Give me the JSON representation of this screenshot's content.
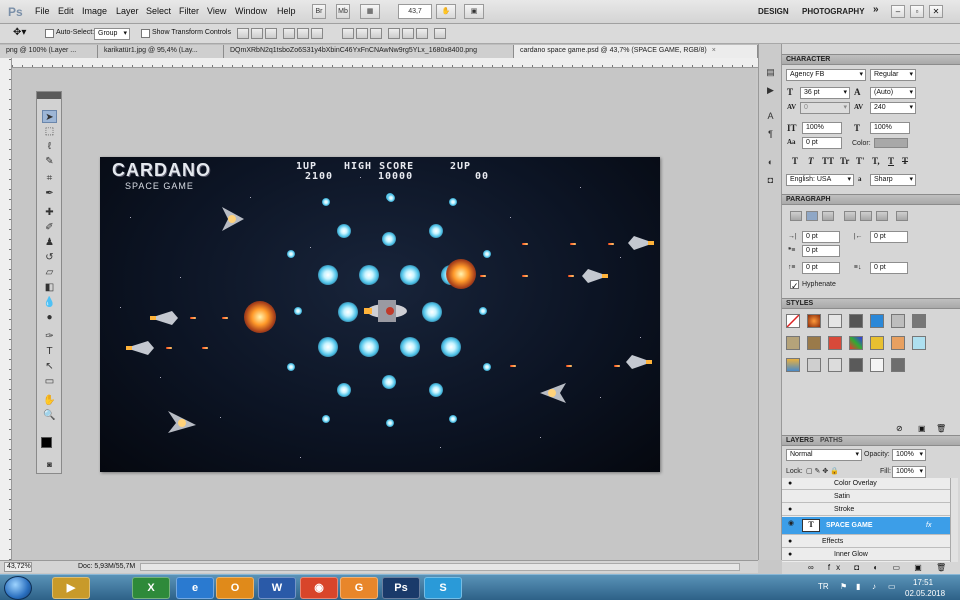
{
  "app": {
    "logo": "Ps"
  },
  "menu": [
    "File",
    "Edit",
    "Image",
    "Layer",
    "Select",
    "Filter",
    "View",
    "Window",
    "Help"
  ],
  "menubar_buttons": {
    "bridge": "Br",
    "minibridge": "Mb",
    "zoom": "43,7"
  },
  "workspace_links": {
    "design": "DESIGN",
    "photography": "PHOTOGRAPHY",
    "more": "»"
  },
  "window_controls": {
    "minimize": "–",
    "restore": "▫",
    "close": "✕"
  },
  "options": {
    "auto_select_label": "Auto-Select:",
    "auto_select_value": "Group",
    "show_transform_label": "Show Transform Controls"
  },
  "tabs": [
    {
      "label": "png @ 100% (Layer ...",
      "active": false
    },
    {
      "label": "karikatür1.jpg @ 95,4% (Lay...",
      "active": false
    },
    {
      "label": "DQmXRbN2q1tsboZo6S31y4bXbinC46YxFnCNAwNw9rg5YLx_1680x8400.png",
      "active": false
    },
    {
      "label": "cardano space game.psd @ 43,7% (SPACE GAME, RGB/8)",
      "active": true
    }
  ],
  "canvas": {
    "title": "CARDANO",
    "subtitle": "SPACE GAME",
    "hud": {
      "p1_label": "1UP",
      "p1_score": "2100",
      "hi_label": "HIGH SCORE",
      "hi_score": "10000",
      "p2_label": "2UP",
      "p2_score": "00"
    }
  },
  "status": {
    "zoom": "43,72%",
    "doc": "Doc: 5,93M/55,7M"
  },
  "character": {
    "title": "CHARACTER",
    "font_family": "Agency FB",
    "font_style": "Regular",
    "size": "36 pt",
    "leading": "(Auto)",
    "kerning": "0",
    "tracking": "240",
    "vscale": "100%",
    "hscale": "100%",
    "baseline": "0 pt",
    "color_label": "Color:",
    "language": "English: USA",
    "aa_label": "a",
    "antialias": "Sharp",
    "type_buttons": [
      "T",
      "T",
      "TT",
      "Tr",
      "T'",
      "T,",
      "T",
      "T"
    ]
  },
  "paragraph": {
    "title": "PARAGRAPH",
    "indent_left": "0 pt",
    "indent_right": "0 pt",
    "indent_first": "0 pt",
    "space_before": "0 pt",
    "space_after": "0 pt",
    "hyphenate_label": "Hyphenate"
  },
  "styles": {
    "title": "STYLES"
  },
  "layers": {
    "tabs": [
      "LAYERS",
      "PATHS"
    ],
    "blend_mode": "Normal",
    "opacity_label": "Opacity:",
    "opacity": "100%",
    "lock_label": "Lock:",
    "fill_label": "Fill:",
    "fill": "100%",
    "rows": [
      "Color Overlay",
      "Satin",
      "Stroke",
      "SPACE GAME",
      "Effects",
      "Inner Glow"
    ],
    "selected_layer_thumb": "T",
    "fx": "fx"
  },
  "taskbar": {
    "apps": [
      "▶",
      "X",
      "e",
      "O",
      "W",
      "◉",
      "G",
      "Ps",
      "S"
    ],
    "lang": "TR",
    "time": "17:51",
    "date": "02.05.2018"
  },
  "colors": {
    "accent_select": "#3c9ee8",
    "orb": "#4ec2e8",
    "bullet": "#ff4a1a"
  }
}
